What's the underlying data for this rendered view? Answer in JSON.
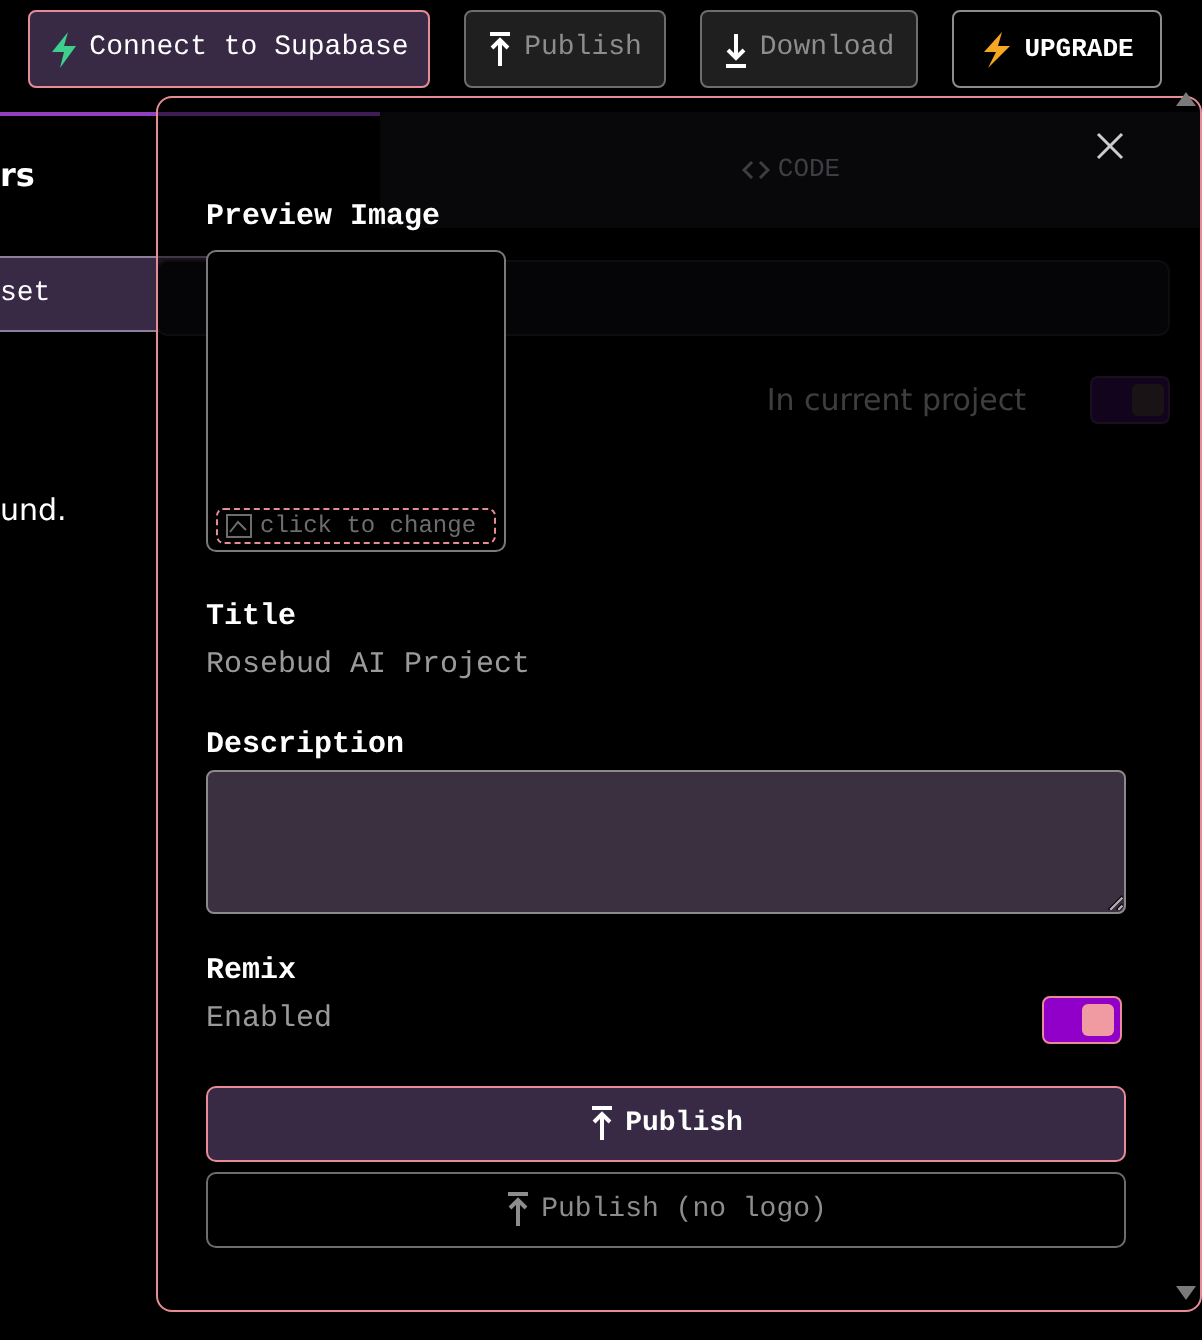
{
  "toolbar": {
    "buttons": [
      {
        "label": "Connect to Supabase",
        "kind": "connect"
      },
      {
        "label": "Publish",
        "kind": "publish"
      },
      {
        "label": "Download",
        "kind": "download"
      },
      {
        "label": "UPGRADE",
        "kind": "upgrade"
      }
    ]
  },
  "background": {
    "sidebar_heading": "rs",
    "sidebar_button": "set",
    "sidebar_text": "und.",
    "tab": "CODE",
    "toggle_label": "In current project",
    "toggle_on": true
  },
  "dialog": {
    "preview_label": "Preview Image",
    "image_button": "click to change",
    "title_label": "Title",
    "title_value": "Rosebud AI Project",
    "description_label": "Description",
    "remix_label": "Remix",
    "remix_value": "Enabled",
    "remix_on": true,
    "buttons": [
      {
        "label": "Publish",
        "kind": "primary"
      },
      {
        "label": "Publish (no logo)",
        "kind": "secondary"
      }
    ]
  }
}
